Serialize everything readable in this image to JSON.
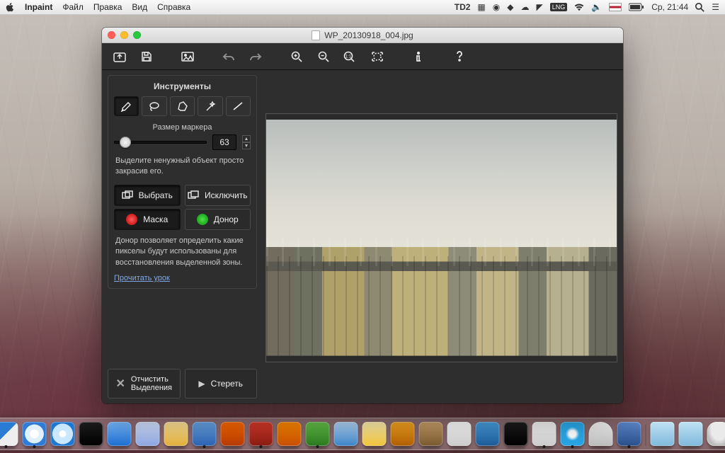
{
  "menubar": {
    "app": "Inpaint",
    "items": [
      "Файл",
      "Правка",
      "Вид",
      "Справка"
    ],
    "right": {
      "td": "D2",
      "clock": "Ср, 21:44"
    }
  },
  "window": {
    "title": "WP_20130918_004.jpg"
  },
  "toolbar": {
    "open": "open",
    "save": "save",
    "picture": "picture",
    "undo": "undo",
    "redo": "redo",
    "zoom_in": "zoom-in",
    "zoom_out": "zoom-out",
    "zoom_11": "1:1",
    "fit": "fit",
    "info": "info",
    "help": "help"
  },
  "sidebar": {
    "tools_title": "Инструменты",
    "tools": [
      "marker",
      "lasso",
      "polygon",
      "magic",
      "line"
    ],
    "marker_label": "Размер маркера",
    "marker_value": "63",
    "hint1": "Выделите ненужный объект просто закрасив его.",
    "select_label": "Выбрать",
    "exclude_label": "Исключить",
    "mask_label": "Маска",
    "donor_label": "Донор",
    "hint2": "Донор позволяет определить какие пикселы будут использованы для восстановления выделенной зоны.",
    "tutorial_link": "Прочитать урок",
    "clear_line1": "Отчистить",
    "clear_line2": "Выделения",
    "erase_label": "Стереть"
  }
}
